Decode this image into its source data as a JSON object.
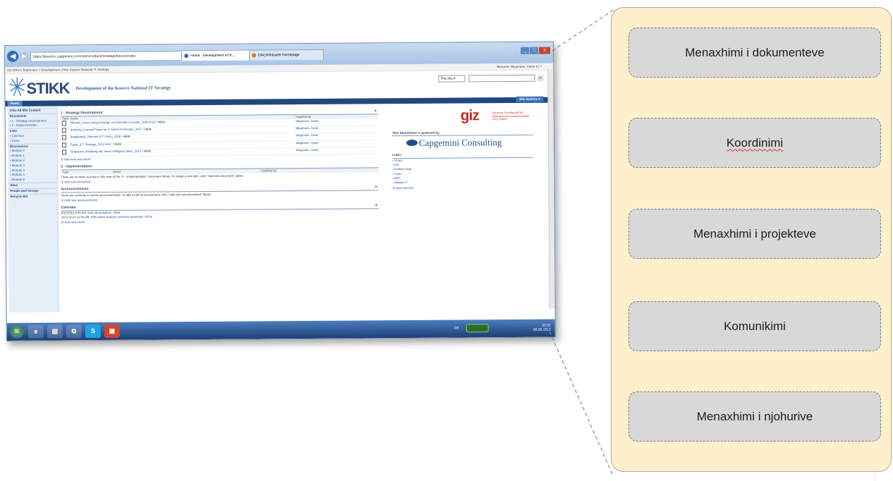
{
  "browser": {
    "address": "https://lessons.capgemini.com/sites/cs/dach/strategy/kosovo/sites",
    "tabs": [
      "Home - Development of th...",
      "DACH/Intranet Homepage"
    ],
    "back_icon": "back-arrow-icon",
    "window_buttons": [
      "_",
      "□",
      "x"
    ]
  },
  "sharepoint": {
    "breadcrumb": "CC DACH Teamroom > Development of the Kosovo National IT Strategy",
    "welcome": "Welcome Wegmann, Xaver ▾ | ?",
    "logo_text": "STIKK",
    "site_title": "Development of the Kosovo National IT Strategy",
    "search_scope": "This Site ▾",
    "top_nav_home": "Home",
    "site_actions": "Site Actions ▾",
    "quick_launch": [
      {
        "label": "View All Site Content",
        "type": "hd"
      },
      {
        "label": "Documents",
        "type": "hd"
      },
      {
        "label": "1 - Strategy Development",
        "type": "sub"
      },
      {
        "label": "2 - Implementation",
        "type": "sub"
      },
      {
        "label": "Lists",
        "type": "hd"
      },
      {
        "label": "Calendar",
        "type": "sub"
      },
      {
        "label": "Tasks",
        "type": "sub"
      },
      {
        "label": "Discussions",
        "type": "hd"
      },
      {
        "label": "Module 0",
        "type": "sub"
      },
      {
        "label": "Module 1",
        "type": "sub"
      },
      {
        "label": "Module 2",
        "type": "sub"
      },
      {
        "label": "Module 3",
        "type": "sub"
      },
      {
        "label": "Module 4",
        "type": "sub"
      },
      {
        "label": "Module 5",
        "type": "sub"
      },
      {
        "label": "Module 6",
        "type": "sub"
      },
      {
        "label": "Sites",
        "type": "hd"
      },
      {
        "label": "People and Groups",
        "type": "hd"
      },
      {
        "label": "Recycle Bin",
        "type": "hd"
      }
    ],
    "strategy": {
      "title": "1 - Strategy Development",
      "col_type": "Type",
      "col_name": "Name",
      "col_modified": "Modified By",
      "rows": [
        {
          "name": "Albania_Cross cutting strategy on information society_2008-2013",
          "mod": "Wegmann, Xaver"
        },
        {
          "name": "Armenia_Concept Paper on IT Sector Promotion_2007",
          "mod": "Wegmann, Xaver"
        },
        {
          "name": "Bangladesh_National ICT Policy_2008",
          "mod": "Wegmann, Xaver"
        },
        {
          "name": "Egypt_ICT Strategy_2012-2017",
          "mod": "Wegmann, Xaver"
        },
        {
          "name": "Singapore_Realising the vision intelligent nation_2015",
          "mod": "Wegmann, Xaver"
        }
      ],
      "new_tag": "! NEW",
      "add": "Add new document"
    },
    "implementation": {
      "title": "2 - Implementation",
      "col_type": "Type",
      "col_name": "Name",
      "col_modified": "Modified By",
      "empty": "There are no items to show in this view of the \"2 - Implementation\" document library. To create a new item, click \"Add new document\" below.",
      "add": "Add new document"
    },
    "announcements": {
      "title": "Announcements",
      "empty": "There are currently no active announcements. To add a new announcement, click \"Add new announcement\" below.",
      "add": "Add new announcement"
    },
    "calendar": {
      "title": "Calendar",
      "rows": [
        {
          "time": "6/15/2013 9:00 AM",
          "title": "Kick-off workshop ! NEW"
        },
        {
          "time": "10/17/2013 12:00 AM",
          "title": "B2B match-making roadshow (planned) ! NEW"
        }
      ],
      "add": "Add new event"
    },
    "right": {
      "giz_logo": "giz",
      "giz_sub": "Deutsche Gesellschaft für Internationale Zusammenarbeit (GIZ) GmbH",
      "powered_title": "This SharePoint is powered by",
      "capgemini": "Capgemini Consulting",
      "links_title": "Links",
      "links": [
        "STIKK",
        "GIZ",
        "Content Leap",
        "Trello",
        "MPS",
        "Hessen IT"
      ],
      "add_link": "Add new link"
    }
  },
  "taskbar": {
    "lang": "DE",
    "time": "20:55",
    "date": "08.08.2013",
    "apps": [
      "e",
      "▤",
      "⧉",
      "S",
      "▣"
    ]
  },
  "panel": {
    "items": [
      "Menaxhimi i dokumenteve",
      "Koordinimi",
      "Menaxhimi i projekteve",
      "Komunikimi",
      "Menaxhimi i njohurive"
    ]
  }
}
